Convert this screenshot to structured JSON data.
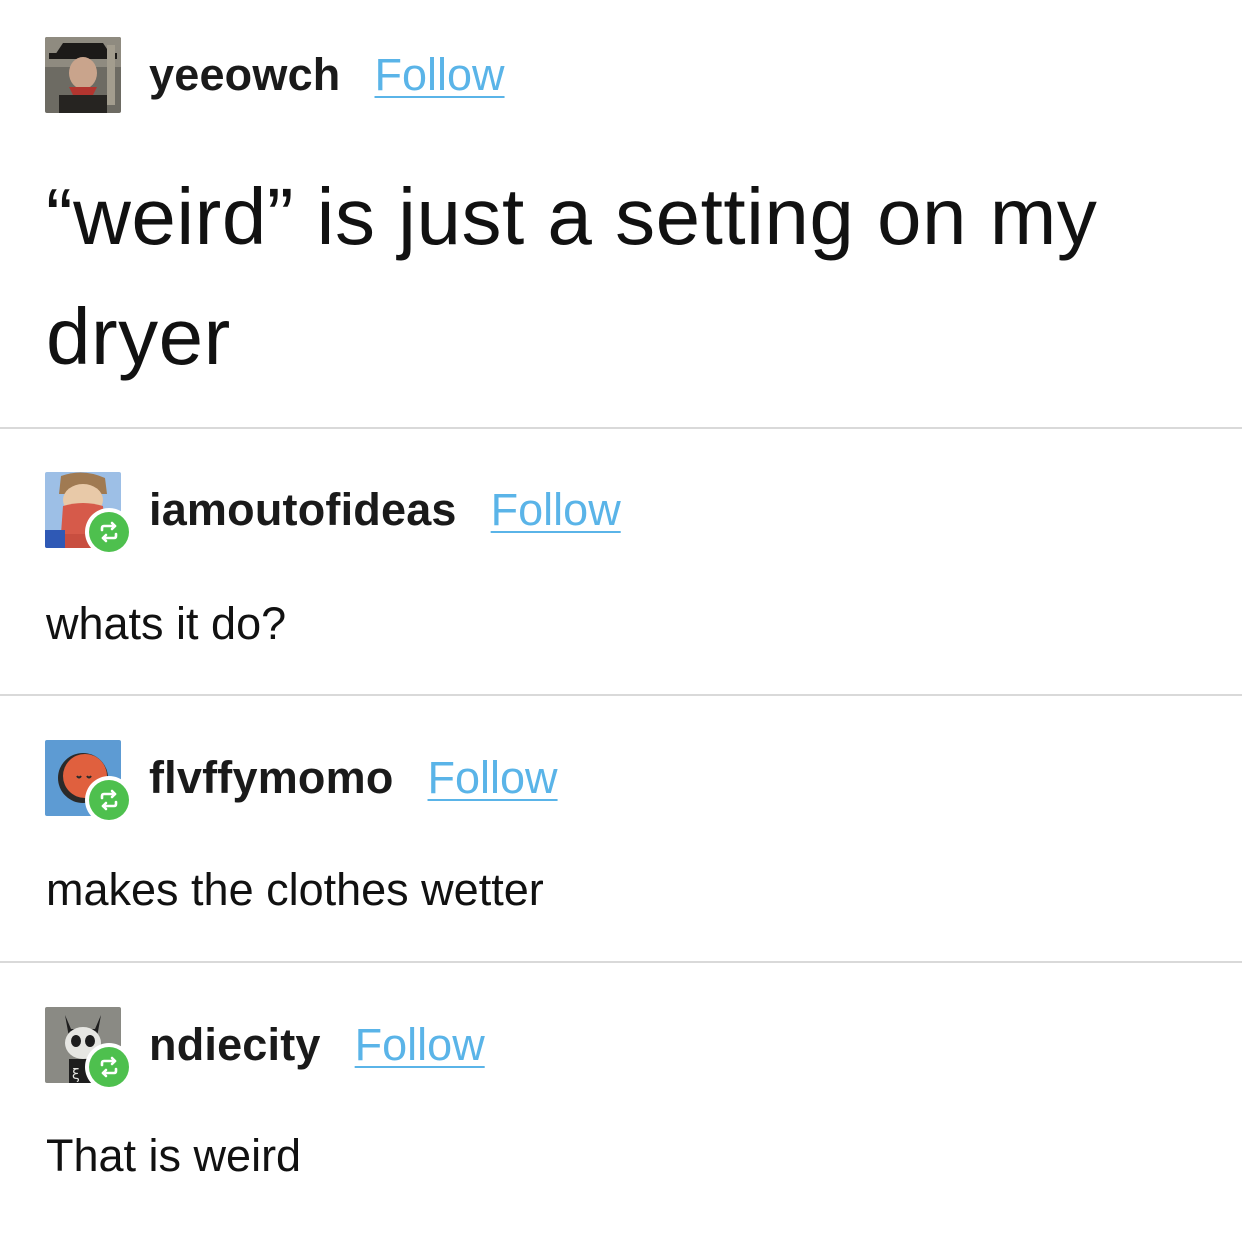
{
  "posts": [
    {
      "username": "yeeowch",
      "follow_label": "Follow",
      "text": "“weird” is just a setting on my dryer",
      "reblogged": false
    },
    {
      "username": "iamoutofideas",
      "follow_label": "Follow",
      "text": "whats it do?",
      "reblogged": true
    },
    {
      "username": "flvffymomo",
      "follow_label": "Follow",
      "text": "makes the clothes wetter",
      "reblogged": true
    },
    {
      "username": "ndiecity",
      "follow_label": "Follow",
      "text": "That is weird",
      "reblogged": true
    }
  ],
  "colors": {
    "follow_link": "#5ab4e8",
    "reblog_badge": "#4ec04e",
    "divider": "#d9d9d9"
  },
  "icons": {
    "reblog": "reblog-icon"
  }
}
